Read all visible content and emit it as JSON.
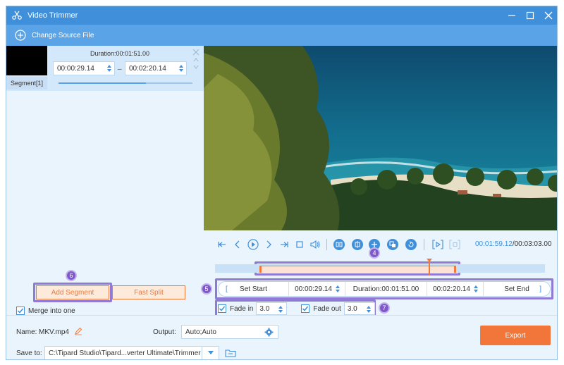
{
  "window": {
    "title": "Video Trimmer",
    "change_source": "Change Source File"
  },
  "segment": {
    "duration": "Duration:00:01:51.00",
    "start": "00:00:29.14",
    "separator": "–",
    "end": "00:02:20.14",
    "tab_label": "Segment[1]"
  },
  "left_actions": {
    "add_segment": "Add Segment",
    "fast_split": "Fast Split",
    "merge_label": "Merge into one",
    "merge_checked": true
  },
  "player": {
    "current_time": "00:01:59.12",
    "separator": "/",
    "total_time": "00:03:03.00",
    "timeline_progress": 0.65
  },
  "range": {
    "set_start": "Set Start",
    "start_time": "00:00:29.14",
    "duration": "Duration:00:01:51.00",
    "end_time": "00:02:20.14",
    "set_end": "Set End",
    "left_bracket": "[",
    "right_bracket": "]"
  },
  "fade": {
    "fade_in_label": "Fade in",
    "fade_in_value": "3.0",
    "fade_out_label": "Fade out",
    "fade_out_value": "3.0"
  },
  "footer": {
    "name_label": "Name:",
    "name_value": "MKV.mp4",
    "output_label": "Output:",
    "output_value": "Auto;Auto",
    "save_label": "Save to:",
    "save_path": "C:\\Tipard Studio\\Tipard...verter Ultimate\\Trimmer",
    "export": "Export"
  },
  "badges": {
    "b4": "4",
    "b5": "5",
    "b6": "6",
    "b7": "7"
  },
  "colors": {
    "title_bar": "#3f8fda",
    "source_bar": "#5aa3e6",
    "accent_orange": "#f2763a",
    "highlight_purple": "#8f7ad6"
  }
}
